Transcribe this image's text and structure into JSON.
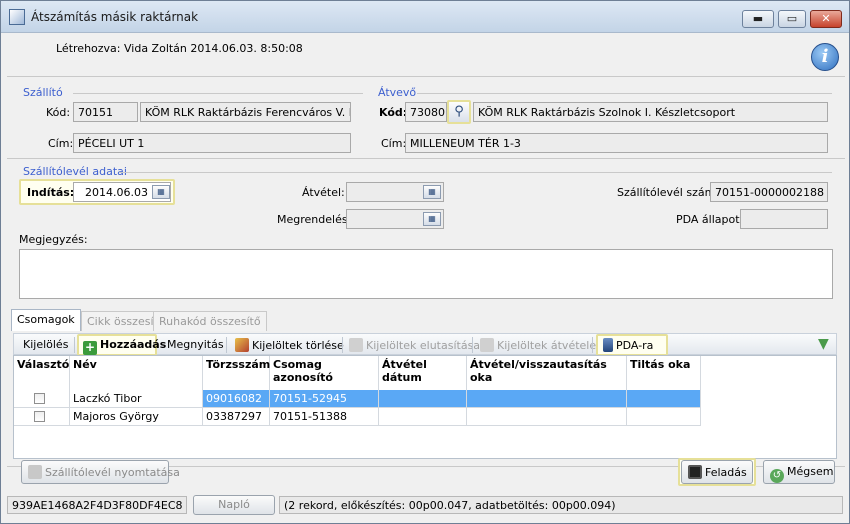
{
  "window": {
    "title": "Átszámítás másik raktárnak",
    "minimize": "▬",
    "maximize": "▭",
    "close": "✕"
  },
  "header": {
    "created": "Létrehozva: Vida Zoltán 2014.06.03. 8:50:08",
    "info_icon": "i"
  },
  "supplier": {
    "legend": "Szállító",
    "code_label": "Kód:",
    "code": "70151",
    "name": "KÖM RLK Raktárbázis Ferencváros  V. Készl",
    "address_label": "Cím:",
    "address": "PÉCELI UT 1"
  },
  "receiver": {
    "legend": "Átvevő",
    "code_label": "Kód:",
    "code": "73080",
    "name": "KÖM RLK Raktárbázis Szolnok I. Készletcsoport",
    "address_label": "Cím:",
    "address": "MILLENEUM TÉR 1-3"
  },
  "delivery": {
    "legend": "Szállítólevél adatai",
    "start_label": "Indítás:",
    "start": "2014.06.03",
    "receipt_label": "Átvétel:",
    "receipt": "",
    "order_label": "Megrendelés:",
    "order": "",
    "note_number_label": "Szállítólevél száma:",
    "note_number": "70151-0000002188",
    "pda_state_label": "PDA állapot:",
    "pda_state": "",
    "comment_label": "Megjegyzés:",
    "comment": ""
  },
  "tabs": [
    "Csomagok",
    "Cikk összesítő",
    "Ruhakód összesítő"
  ],
  "toolbar": {
    "select": "Kijelölés",
    "add": "Hozzáadás",
    "cancel": "Megnyitás",
    "delete": "Kijelöltek törlése",
    "reject": "Kijelöltek elutasítása",
    "accept": "Kijelöltek átvétele",
    "pda": "PDA-ra"
  },
  "grid": {
    "headers": [
      "Választó",
      "Név",
      "Törzsszám",
      "Csomag azonosító",
      "Átvétel dátum",
      "Átvétel/visszautasítás oka",
      "Tiltás oka"
    ],
    "rows": [
      {
        "name": "Laczkó Tibor",
        "id": "09016082",
        "package": "70151-52945",
        "date": "",
        "reason": "",
        "ban": ""
      },
      {
        "name": "Majoros György",
        "id": "03387297",
        "package": "70151-51388",
        "date": "",
        "reason": "",
        "ban": ""
      }
    ]
  },
  "buttons": {
    "print": "Szállítólevél nyomtatása",
    "send": "Feladás",
    "cancel": "Mégsem"
  },
  "status": {
    "hash": "939AE1468A2F4D3F80DF4EC8",
    "log": "Napló",
    "info": "(2 rekord, előkészítés: 00p00.047, adatbetöltés: 00p00.094)"
  },
  "colors": {
    "selection": "#5aa8f5",
    "legend": "#3c5fcf",
    "highlight": "#e6e098"
  }
}
